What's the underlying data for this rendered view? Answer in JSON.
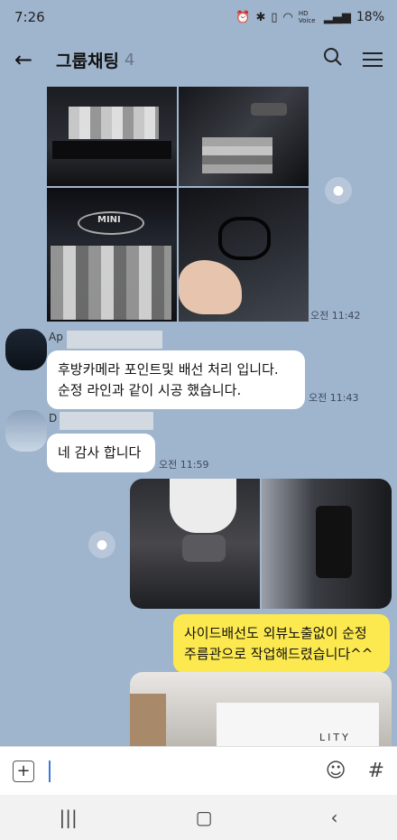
{
  "status": {
    "time": "7:26",
    "battery": "18%",
    "icons": [
      "alarm-icon",
      "bluetooth-icon",
      "vibrate-icon",
      "wifi-icon",
      "signal-icon"
    ],
    "hd": "HD Voice"
  },
  "header": {
    "title": "그룹채팅",
    "count": "4"
  },
  "messages": {
    "t1": "오전 11:42",
    "sender1": "Ap",
    "msg1": "후방카메라 포인트및 배선 처리 입니다.\n순정 라인과 같이 시공 했습니다.",
    "t2": "오전 11:43",
    "sender2": "D",
    "msg2": "네 감사 합니다",
    "t3": "오전 11:59",
    "msg3": "사이드배선도 외뷰노출없이 순정\n주름관으로 작업해드렸습니다^^"
  },
  "photo_text": {
    "mini": "MINI",
    "lity": "LITY"
  },
  "input": {
    "placeholder": ""
  }
}
